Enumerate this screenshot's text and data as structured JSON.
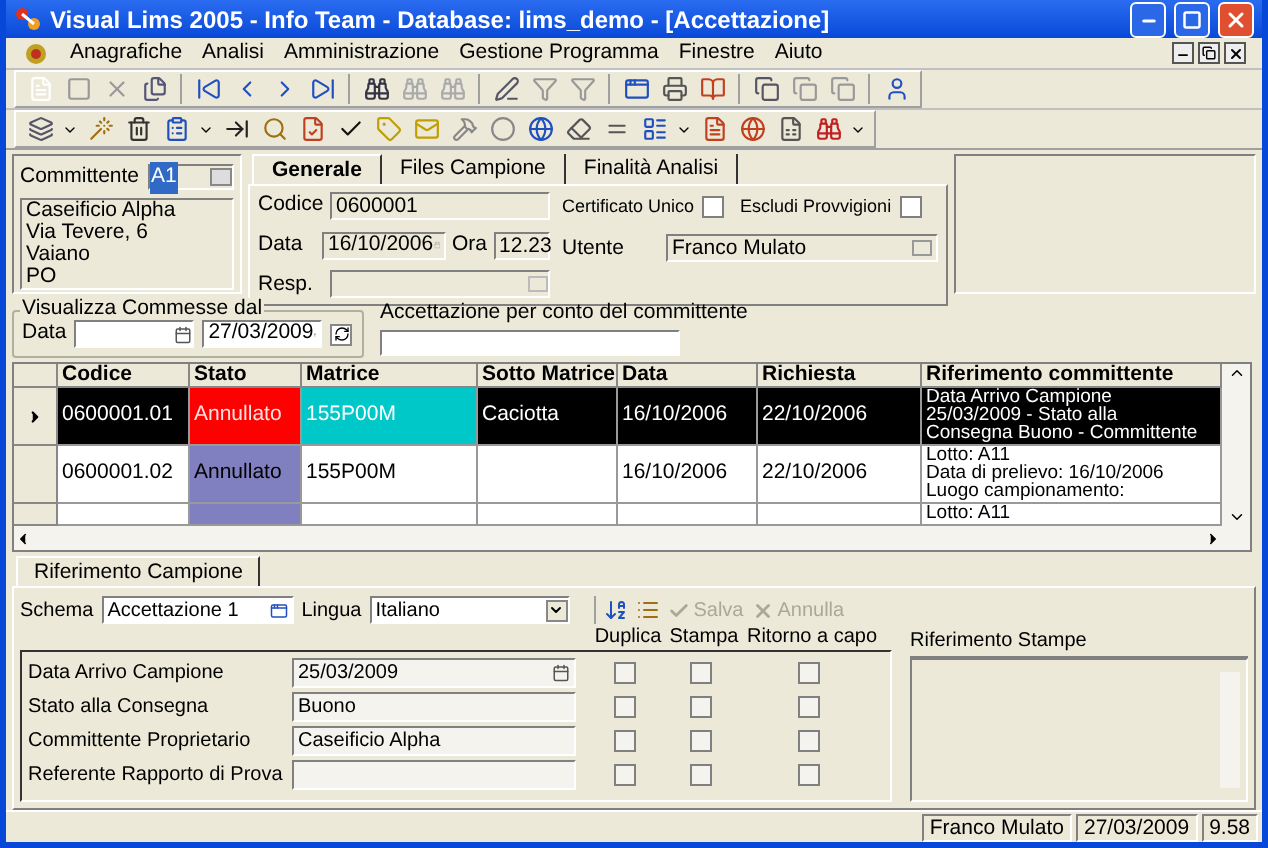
{
  "window": {
    "title": "Visual Lims 2005 - Info Team - Database: lims_demo - [Accettazione]"
  },
  "menu": [
    "Anagrafiche",
    "Analisi",
    "Amministrazione",
    "Gestione Programma",
    "Finestre",
    "Aiuto"
  ],
  "committente": {
    "label": "Committente",
    "value": "A1",
    "value_highlighted": true,
    "address": "Caseificio Alpha\nVia Tevere, 6\nVaiano\nPO"
  },
  "tabs": [
    {
      "label": "Generale",
      "selected": true
    },
    {
      "label": "Files Campione",
      "selected": false
    },
    {
      "label": "Finalità Analisi",
      "selected": false
    }
  ],
  "generale": {
    "codice_label": "Codice",
    "codice": "0600001",
    "data_label": "Data",
    "data": "16/10/2006",
    "ora_label": "Ora",
    "ora": "12.23",
    "resp_label": "Resp.",
    "checks": [
      {
        "label": "Certificato Unico",
        "checked": false
      },
      {
        "label": "Escludi Provvigioni",
        "checked": false
      }
    ],
    "utente_label": "Utente",
    "utente": "Franco Mulato"
  },
  "filter": {
    "title": "Visualizza Commesse dal",
    "data_label": "Data",
    "to": "27/03/2009",
    "conto_label": "Accettazione per conto del committente"
  },
  "table": {
    "columns": [
      "Codice",
      "Stato",
      "Matrice",
      "Sotto Matrice",
      "Data",
      "Richiesta",
      "Riferimento committente"
    ],
    "rows": [
      {
        "selected": true,
        "codice": "0600001.01",
        "stato": {
          "text": "Annullato",
          "color": "#ff0000"
        },
        "matrice": {
          "text": "155P00M",
          "color": "#00c8c8"
        },
        "sotto_matrice": "Caciotta",
        "data": "16/10/2006",
        "richiesta": "22/10/2006",
        "riferimento": "Data Arrivo Campione\n25/03/2009 - Stato alla\nConsegna Buono - Committente"
      },
      {
        "selected": false,
        "codice": "0600001.02",
        "stato": {
          "text": "Annullato",
          "color": "#8080c0"
        },
        "matrice": {
          "text": "155P00M"
        },
        "data": "16/10/2006",
        "richiesta": "22/10/2006",
        "riferimento": "Lotto: A11\nData di prelievo: 16/10/2006\nLuogo campionamento:"
      },
      {
        "selected": false,
        "stato": {
          "color": "#8080c0"
        },
        "riferimento": "Lotto: A11"
      }
    ]
  },
  "bottom": {
    "tabs": [
      {
        "label": "Riferimento Campione",
        "selected": true
      }
    ],
    "schema_label": "Schema",
    "schema": "Accettazione 1",
    "lingua_label": "Lingua",
    "lingua": "Italiano",
    "actions": [
      {
        "label": "Salva",
        "disabled": true
      },
      {
        "label": "Annulla",
        "disabled": true
      }
    ],
    "check_columns": [
      "Duplica",
      "Stampa",
      "Ritorno a capo"
    ],
    "fields": [
      {
        "label": "Data Arrivo Campione",
        "value": "25/03/2009",
        "kind": "date",
        "checks": [
          false,
          false,
          false
        ]
      },
      {
        "label": "Stato alla Consegna",
        "value": "Buono",
        "kind": "text",
        "checks": [
          false,
          false,
          false
        ]
      },
      {
        "label": "Committente Proprietario",
        "value": "Caseificio Alpha",
        "kind": "text",
        "checks": [
          false,
          false,
          false
        ]
      },
      {
        "label": "Referente Rapporto di Prova",
        "kind": "text",
        "checks": [
          false,
          false,
          false
        ]
      }
    ],
    "stampe_label": "Riferimento Stampe"
  },
  "status_bar": [
    "Franco Mulato",
    "27/03/2009",
    "9.58"
  ]
}
